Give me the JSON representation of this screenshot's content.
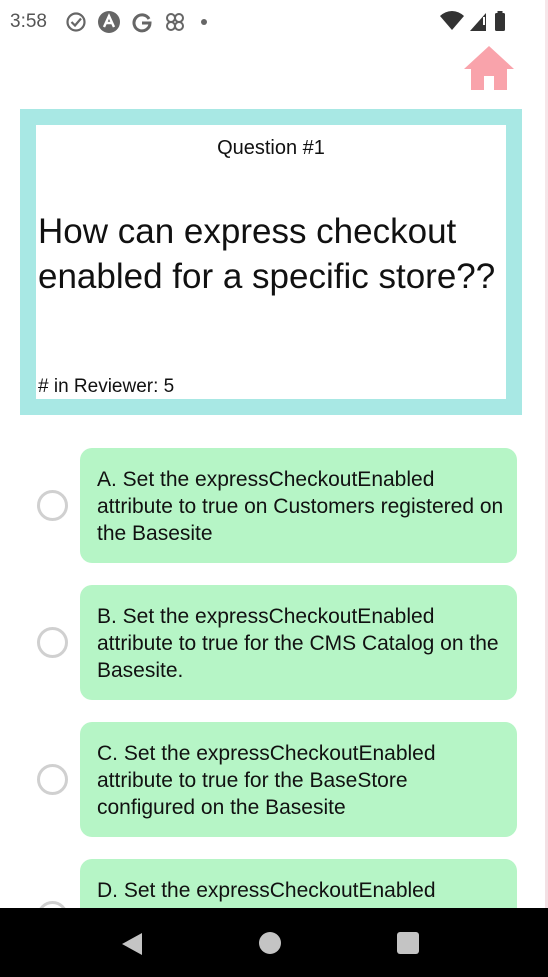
{
  "status_bar": {
    "time": "3:58",
    "left_icons": [
      "check-circle-icon",
      "a-badge-icon",
      "g-icon",
      "pinwheel-icon",
      "dot-icon"
    ],
    "right_icons": [
      "wifi-icon",
      "signal-icon",
      "battery-icon"
    ]
  },
  "header": {
    "home_icon": "home-icon",
    "home_color": "#f9a3ab"
  },
  "question": {
    "number_label": "Question #1",
    "text": "How can express checkout enabled for a specific store??",
    "reviewer_label": "# in Reviewer: 5",
    "frame_color": "#a8e8e4"
  },
  "options": [
    {
      "text": "A. Set the expressCheckoutEnabled attribute to true on Customers registered on the Basesite",
      "selected": false
    },
    {
      "text": "B. Set the expressCheckoutEnabled attribute to true for the CMS Catalog on the Basesite.",
      "selected": false
    },
    {
      "text": "C. Set the expressCheckoutEnabled attribute to true for the BaseStore configured on the Basesite",
      "selected": false
    },
    {
      "text": "D. Set the expressCheckoutEnabled",
      "selected": false
    }
  ],
  "option_color": "#b6f5c6",
  "nav_bar": {
    "icons": [
      "back-icon",
      "home-circle-icon",
      "recents-icon"
    ]
  }
}
